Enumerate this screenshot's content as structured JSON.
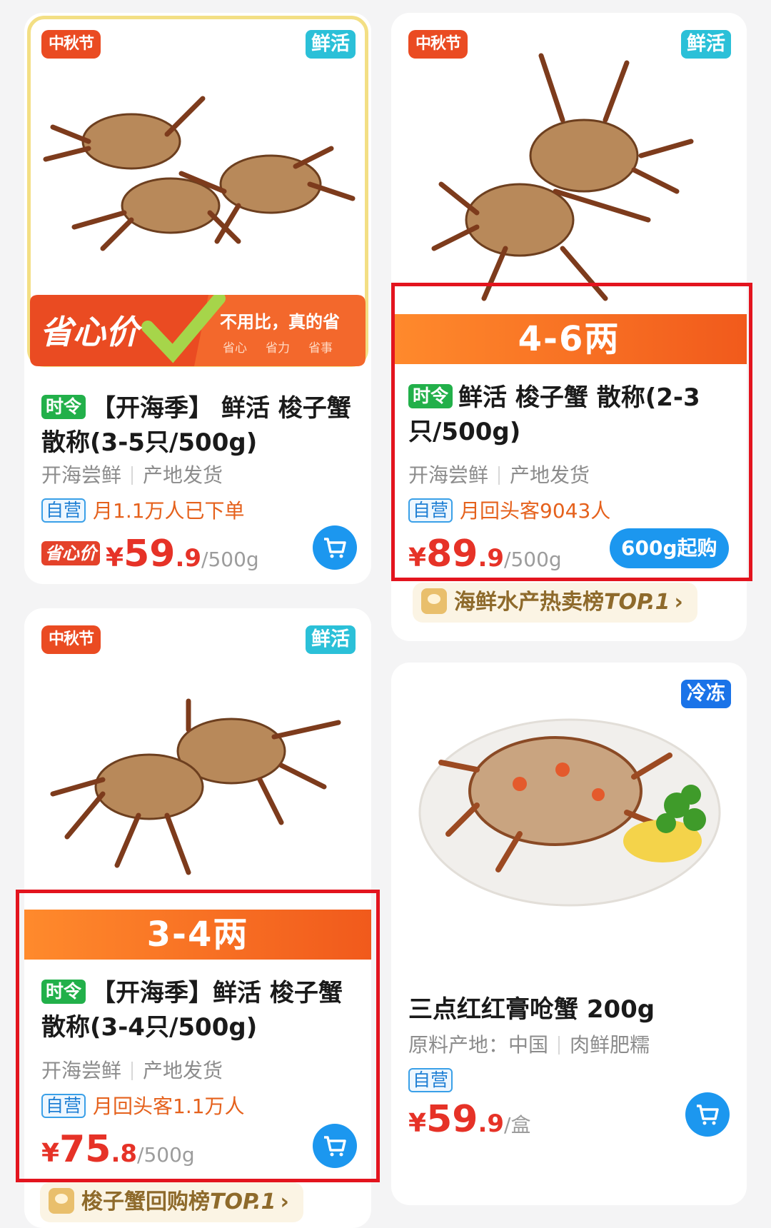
{
  "products": [
    {
      "promo_tag": "中秋节",
      "fresh_tag": "鲜活",
      "banner": {
        "title": "省心价",
        "slogan": "不用比，真的省",
        "points": [
          "省心",
          "省力",
          "省事"
        ]
      },
      "season_tag": "时令",
      "title": "【开海季】 鲜活 梭子蟹 散称(3-5只/500g)",
      "meta": [
        "开海尝鲜",
        "产地发货"
      ],
      "self_tag": "自营",
      "stat": "月1.1万人已下单",
      "save_tag": "省心价",
      "price": {
        "currency": "¥",
        "int": "59",
        "dec": ".9",
        "unit": "/500g"
      }
    },
    {
      "promo_tag": "中秋节",
      "fresh_tag": "鲜活",
      "weight": "4-6两",
      "season_tag": "时令",
      "title": "鲜活 梭子蟹 散称(2-3只/500g)",
      "meta": [
        "开海尝鲜",
        "产地发货"
      ],
      "self_tag": "自营",
      "stat": "月回头客9043人",
      "price": {
        "currency": "¥",
        "int": "89",
        "dec": ".9",
        "unit": "/500g"
      },
      "min_buy": "600g起购",
      "rank": {
        "text": "海鲜水产热卖榜",
        "top": "TOP.1",
        "arrow": "›"
      }
    },
    {
      "promo_tag": "中秋节",
      "fresh_tag": "鲜活",
      "weight": "3-4两",
      "season_tag": "时令",
      "title": "【开海季】鲜活 梭子蟹 散称(3-4只/500g)",
      "meta": [
        "开海尝鲜",
        "产地发货"
      ],
      "self_tag": "自营",
      "stat": "月回头客1.1万人",
      "price": {
        "currency": "¥",
        "int": "75",
        "dec": ".8",
        "unit": "/500g"
      },
      "rank": {
        "text": "梭子蟹回购榜",
        "top": "TOP.1",
        "arrow": "›"
      }
    },
    {
      "frozen_tag": "冷冻",
      "title": "三点红红膏呛蟹 200g",
      "meta": [
        "原料产地：中国",
        "肉鲜肥糯"
      ],
      "self_tag": "自营",
      "price": {
        "currency": "¥",
        "int": "59",
        "dec": ".9",
        "unit": "/盒"
      }
    }
  ],
  "colors": {
    "highlight_box": "#e3141e",
    "price": "#e63227",
    "cart": "#1c97ef",
    "weight_band": "#f15a1c"
  }
}
